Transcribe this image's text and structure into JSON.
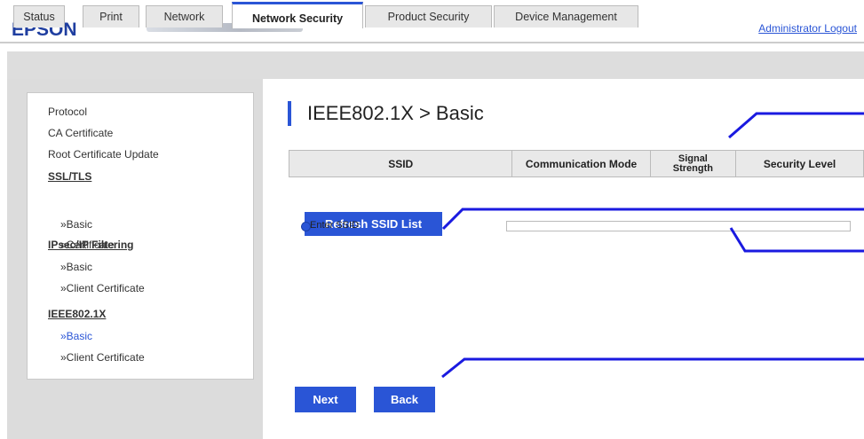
{
  "header": {
    "logo": "EPSON",
    "admin_logout": "Administrator Logout"
  },
  "tabs": [
    {
      "label": "Status",
      "active": false
    },
    {
      "label": "Print",
      "active": false
    },
    {
      "label": "Network",
      "active": false
    },
    {
      "label": "Network Security",
      "active": true
    },
    {
      "label": "Product Security",
      "active": false
    },
    {
      "label": "Device Management",
      "active": false
    }
  ],
  "sidebar": {
    "items": [
      {
        "label": "Protocol",
        "kind": "item"
      },
      {
        "label": "CA Certificate",
        "kind": "item"
      },
      {
        "label": "Root Certificate Update",
        "kind": "item"
      },
      {
        "label": "SSL/TLS",
        "kind": "heading"
      },
      {
        "label": "»Basic",
        "kind": "sub"
      },
      {
        "label": "»Certificate",
        "kind": "sub"
      },
      {
        "label": "IPsec/IP Filtering",
        "kind": "heading"
      },
      {
        "label": "»Basic",
        "kind": "sub"
      },
      {
        "label": "»Client Certificate",
        "kind": "sub"
      },
      {
        "label": "IEEE802.1X",
        "kind": "heading"
      },
      {
        "label": "»Basic",
        "kind": "sub",
        "active": true
      },
      {
        "label": "»Client Certificate",
        "kind": "sub"
      }
    ]
  },
  "main": {
    "title": "IEEE802.1X > Basic",
    "table_headers": [
      "SSID",
      "Communication Mode",
      "Signal\nStrength",
      "Security Level"
    ],
    "signal_line1": "Signal",
    "signal_line2": "Strength",
    "refresh_button": "Refresh SSID List",
    "enter_ssid_label": "Enter SSID",
    "ssid_value": "",
    "next_button": "Next",
    "back_button": "Back"
  },
  "colors": {
    "accent": "#2a55d6",
    "brand": "#1f3ea0",
    "callout_line": "#1a1ae0"
  }
}
